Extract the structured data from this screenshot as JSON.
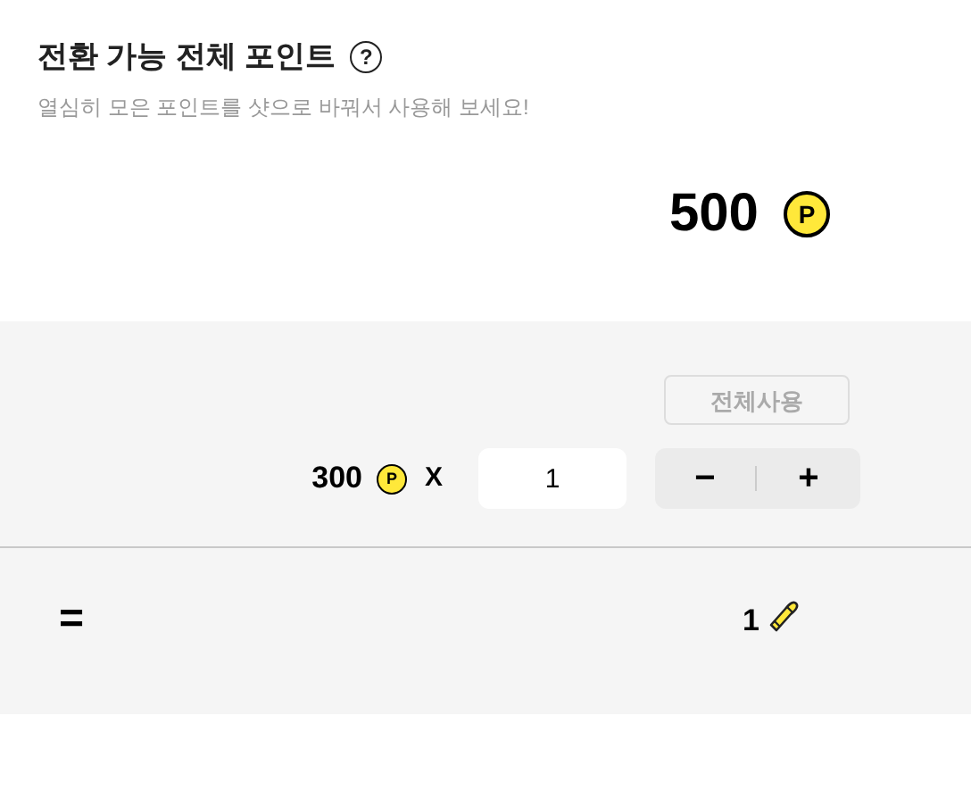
{
  "header": {
    "title": "전환 가능 전체 포인트",
    "help_icon": "?",
    "subtitle": "열심히 모은 포인트를 샷으로 바꿔서 사용해 보세요!"
  },
  "total": {
    "amount": "500",
    "coin": "P"
  },
  "use_all_button": {
    "label": "전체사용",
    "disabled": true
  },
  "exchange": {
    "unit_amount": "300",
    "coin": "P",
    "times": "X",
    "quantity": "1",
    "minus": "−",
    "plus": "+"
  },
  "result": {
    "equals": "=",
    "shots": "1"
  }
}
